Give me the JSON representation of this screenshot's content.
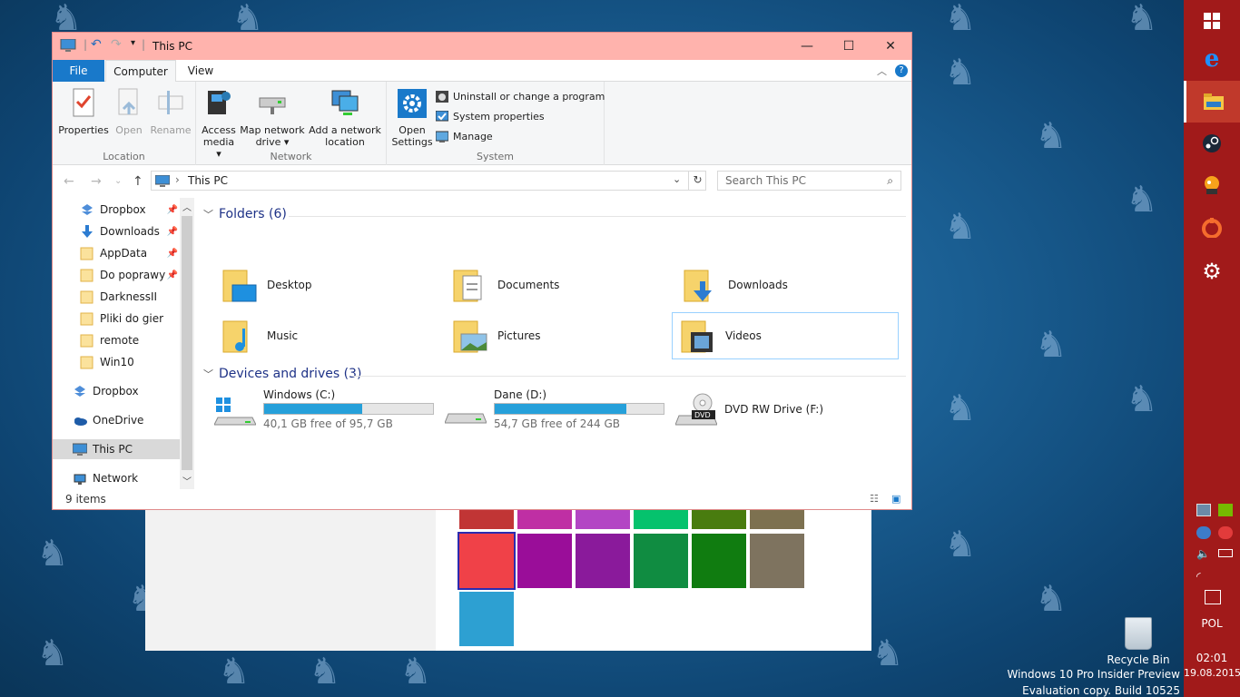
{
  "window": {
    "title": "This PC"
  },
  "ribbon": {
    "tabs": {
      "file": "File",
      "computer": "Computer",
      "view": "View"
    },
    "groups": {
      "location": {
        "label": "Location",
        "properties": "Properties",
        "open": "Open",
        "rename": "Rename"
      },
      "network": {
        "label": "Network",
        "access_media_1": "Access",
        "access_media_2": "media ▾",
        "map_drive_1": "Map network",
        "map_drive_2": "drive ▾",
        "add_location_1": "Add a network",
        "add_location_2": "location"
      },
      "system": {
        "label": "System",
        "open_settings_1": "Open",
        "open_settings_2": "Settings",
        "uninstall": "Uninstall or change a program",
        "sys_props": "System properties",
        "manage": "Manage"
      }
    }
  },
  "address": {
    "path": "This PC",
    "search_placeholder": "Search This PC"
  },
  "navpane": {
    "items": [
      {
        "label": "Dropbox",
        "pinned": true
      },
      {
        "label": "Downloads",
        "pinned": true
      },
      {
        "label": "AppData",
        "pinned": true
      },
      {
        "label": "Do poprawy",
        "pinned": true
      },
      {
        "label": "DarknessII",
        "pinned": false
      },
      {
        "label": "Pliki do gier",
        "pinned": false
      },
      {
        "label": "remote",
        "pinned": false
      },
      {
        "label": "Win10",
        "pinned": false
      }
    ],
    "roots": [
      "Dropbox",
      "OneDrive",
      "This PC",
      "Network"
    ]
  },
  "folders": {
    "title": "Folders (6)",
    "items": [
      "Desktop",
      "Documents",
      "Downloads",
      "Music",
      "Pictures",
      "Videos"
    ]
  },
  "drives": {
    "title": "Devices and drives (3)",
    "items": [
      {
        "name": "Windows (C:)",
        "free": "40,1 GB free of 95,7 GB",
        "used_fraction": 0.58
      },
      {
        "name": "Dane (D:)",
        "free": "54,7 GB free of 244 GB",
        "used_fraction": 0.78
      },
      {
        "name": "DVD RW Drive (F:)"
      }
    ]
  },
  "status": {
    "items": "9 items"
  },
  "desktop": {
    "recycle_bin": "Recycle Bin",
    "watermark_1": "Windows 10 Pro Insider Preview",
    "watermark_2": "Evaluation copy. Build 10525"
  },
  "taskbar": {
    "lang": "POL",
    "time": "02:01",
    "date": "19.08.2015"
  },
  "colors": {
    "accent": "#1979ca",
    "titlebar": "#ffb3ad",
    "taskbar": "#a11a1a",
    "drive_bar": "#26a0da"
  }
}
